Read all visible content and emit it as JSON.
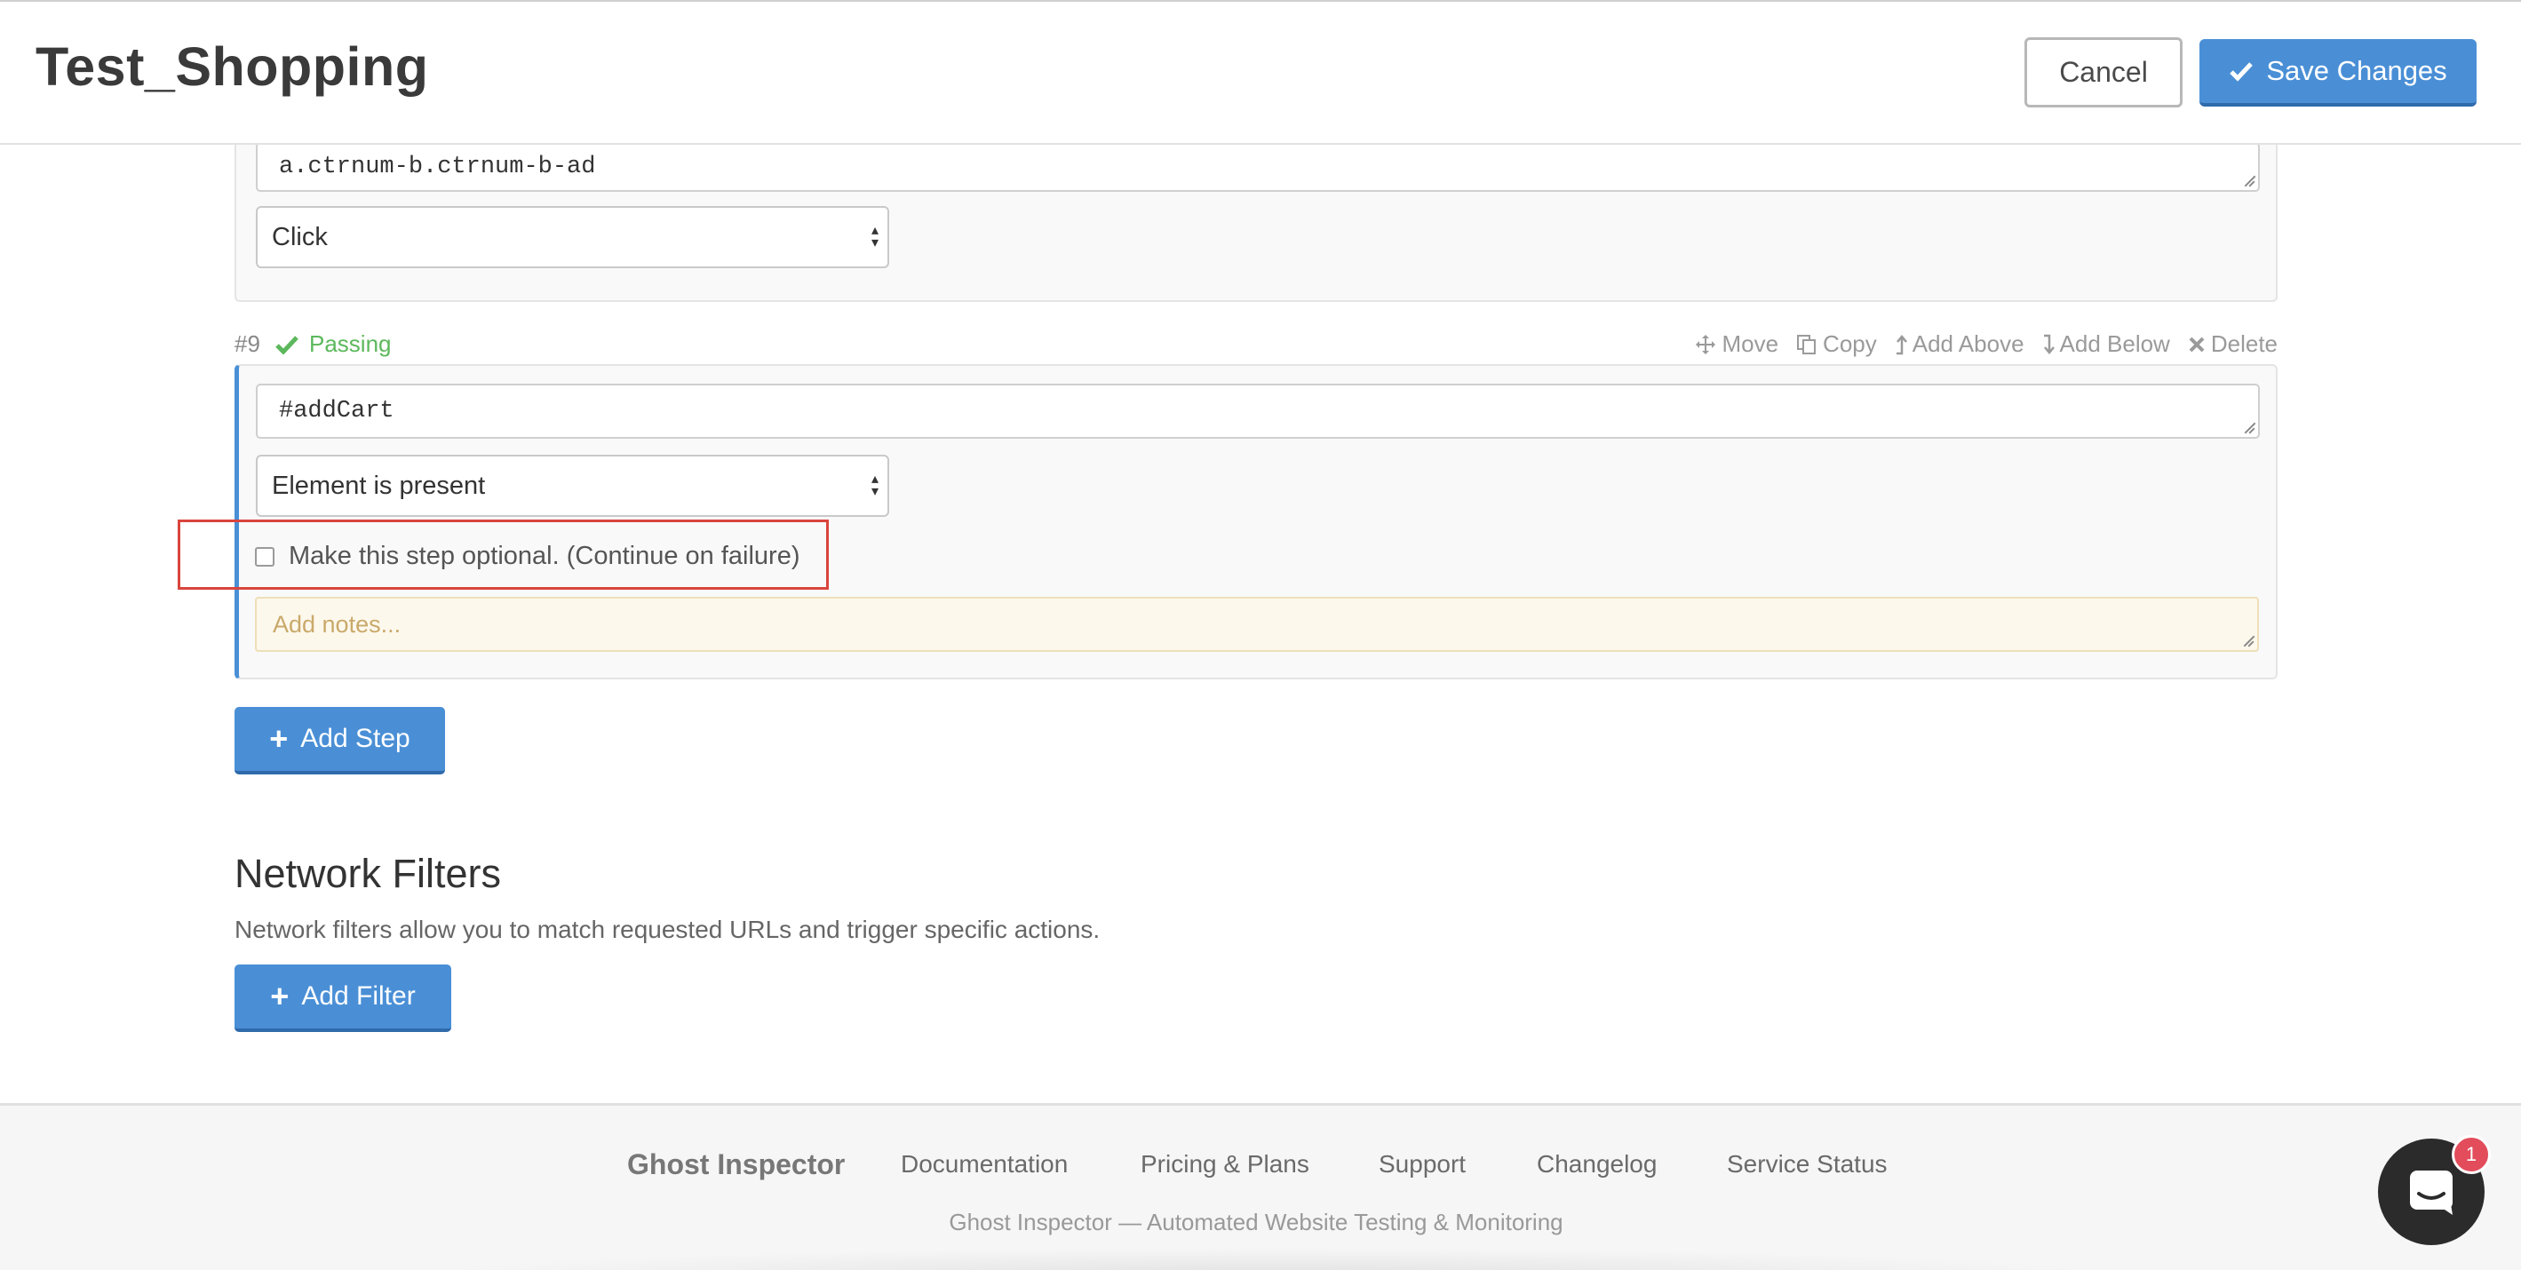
{
  "header": {
    "title": "Test_Shopping",
    "cancel_label": "Cancel",
    "save_label": "Save Changes"
  },
  "step8": {
    "selector": "a.ctrnum-b.ctrnum-b-ad",
    "action": "Click"
  },
  "step9": {
    "number": "#9",
    "status": "Passing",
    "actions": {
      "move": "Move",
      "copy": "Copy",
      "add_above": "Add Above",
      "add_below": "Add Below",
      "delete": "Delete"
    },
    "selector": "#addCart",
    "assertion": "Element is present",
    "optional_label": "Make this step optional. (Continue on failure)",
    "optional_checked": false,
    "notes_placeholder": "Add notes..."
  },
  "add_step_label": "Add Step",
  "network_filters": {
    "title": "Network Filters",
    "description": "Network filters allow you to match requested URLs and trigger specific actions.",
    "add_filter_label": "Add Filter"
  },
  "footer": {
    "brand": "Ghost Inspector",
    "links": [
      "Documentation",
      "Pricing & Plans",
      "Support",
      "Changelog",
      "Service Status"
    ],
    "tagline": "Ghost Inspector — Automated Website Testing & Monitoring"
  },
  "chat": {
    "badge_count": "1"
  },
  "colors": {
    "primary": "#4a8fd6",
    "success": "#5cb85c",
    "highlight": "#d9453d",
    "badge": "#e24c5b"
  }
}
